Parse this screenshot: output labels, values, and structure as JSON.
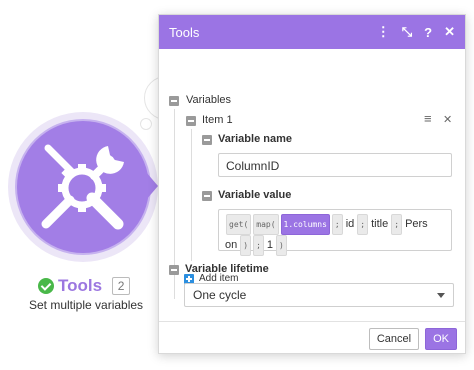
{
  "module": {
    "title": "Tools",
    "badge": "2",
    "subtitle": "Set multiple variables",
    "icon": "wrench-screwdriver-gear-icon",
    "accent_color": "#a27ee6"
  },
  "dialog": {
    "title": "Tools",
    "header_color": "#9b74e4",
    "tools": {
      "menu": "⋮",
      "expand": "⤡",
      "help": "?",
      "close": "✕"
    },
    "variables_label": "Variables",
    "item": {
      "label": "Item 1",
      "name_label": "Variable name",
      "name_value": "ColumnID",
      "value_label": "Variable value",
      "value_tokens_line1": {
        "get": "get(",
        "map": "map(",
        "columns": "1.columns",
        "sep1": ";",
        "id": "id",
        "sep2": ";",
        "title": "title",
        "sep3": ";",
        "pers": "Pers"
      },
      "value_tokens_line2": {
        "on": "on",
        "close1": ")",
        "sep": ";",
        "one": "1",
        "close2": ")"
      }
    },
    "add_item": "Add item",
    "lifetime_label": "Variable lifetime",
    "lifetime_value": "One cycle",
    "cancel": "Cancel",
    "ok": "OK"
  }
}
